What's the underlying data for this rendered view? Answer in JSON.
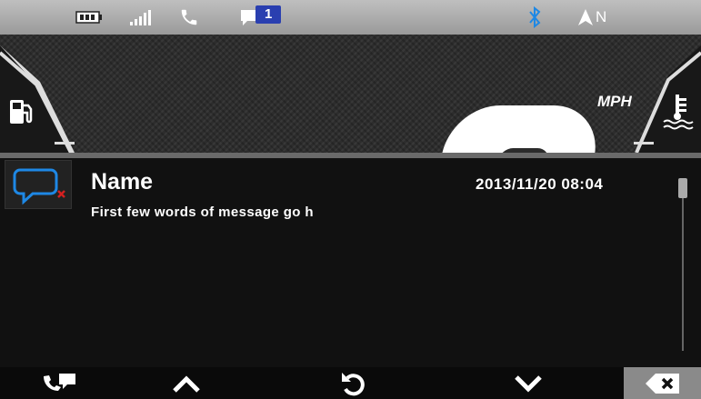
{
  "status_bar": {
    "unread_count": "1",
    "compass_heading": "N",
    "icons": [
      "battery-icon",
      "signal-icon",
      "phone-icon",
      "message-icon",
      "bluetooth-icon",
      "compass-arrow-icon"
    ]
  },
  "dashboard": {
    "speed_unit": "MPH",
    "icons": [
      "fuel-icon",
      "coolant-temperature-icon"
    ]
  },
  "message": {
    "sender": "Name",
    "timestamp": "2013/11/20 08:04",
    "preview": "First few words of message go h",
    "icon": "message-unread-icon"
  },
  "bottom_bar": {
    "buttons": [
      "call-message-icon",
      "chevron-up-icon",
      "refresh-icon",
      "chevron-down-icon",
      "delete-icon"
    ]
  },
  "colors": {
    "status_bar": "#b0b0b0",
    "accent_blue": "#1e88e5",
    "badge_blue": "#2a3fb0",
    "delete_x": "#d42020"
  }
}
